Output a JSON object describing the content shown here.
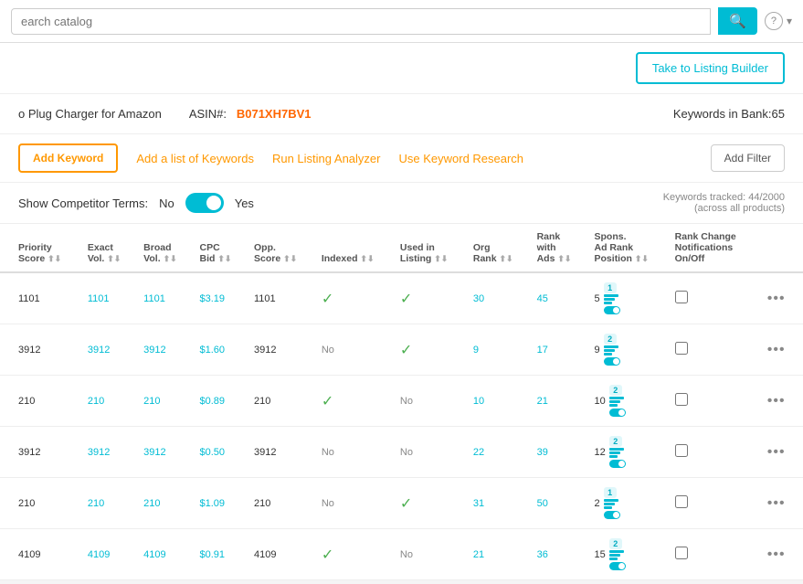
{
  "topbar": {
    "search_placeholder": "earch catalog",
    "search_icon": "🔍",
    "help_icon": "?"
  },
  "action_bar": {
    "listing_builder_label": "Take to Listing Builder"
  },
  "product": {
    "name": "o Plug Charger for Amazon",
    "asin_label": "ASIN#:",
    "asin_value": "B071XH7BV1",
    "keywords_in_bank": "Keywords in Bank:",
    "keywords_count": "65"
  },
  "toolbar": {
    "add_keyword": "Add Keyword",
    "add_list": "Add a list of Keywords",
    "run_analyzer": "Run Listing Analyzer",
    "use_research": "Use Keyword Research",
    "add_filter": "Add Filter"
  },
  "competitor": {
    "label": "Show Competitor Terms:",
    "no": "No",
    "yes": "Yes",
    "tracked_label": "Keywords tracked: 44/2000",
    "tracked_sub": "(across all products)"
  },
  "table": {
    "headers": [
      "Priority Score",
      "Exact Vol.",
      "Broad Vol.",
      "CPC Bid",
      "Opp. Score",
      "Indexed",
      "Used in Listing",
      "Org Rank",
      "Rank with Ads",
      "Spons. Ad Rank Position",
      "Rank Change Notifications On/Off"
    ],
    "rows": [
      {
        "priority": "1101",
        "exact": "1101",
        "broad": "1101",
        "cpc": "$3.19",
        "opp": "1101",
        "indexed": true,
        "indexed_text": "",
        "used_in_listing": true,
        "used_text": "",
        "org_rank": "30",
        "rank_with_ads": "45",
        "spons_rank": "5",
        "spons_badge": "1",
        "checked": false
      },
      {
        "priority": "3912",
        "exact": "3912",
        "broad": "3912",
        "cpc": "$1.60",
        "opp": "3912",
        "indexed": false,
        "indexed_text": "No",
        "used_in_listing": true,
        "used_text": "",
        "org_rank": "9",
        "rank_with_ads": "17",
        "spons_rank": "9",
        "spons_badge": "2",
        "checked": false
      },
      {
        "priority": "210",
        "exact": "210",
        "broad": "210",
        "cpc": "$0.89",
        "opp": "210",
        "indexed": true,
        "indexed_text": "",
        "used_in_listing": false,
        "used_text": "No",
        "org_rank": "10",
        "rank_with_ads": "21",
        "spons_rank": "10",
        "spons_badge": "2",
        "checked": false
      },
      {
        "priority": "3912",
        "exact": "3912",
        "broad": "3912",
        "cpc": "$0.50",
        "opp": "3912",
        "indexed": false,
        "indexed_text": "No",
        "used_in_listing": false,
        "used_text": "No",
        "org_rank": "22",
        "rank_with_ads": "39",
        "spons_rank": "12",
        "spons_badge": "2",
        "checked": false
      },
      {
        "priority": "210",
        "exact": "210",
        "broad": "210",
        "cpc": "$1.09",
        "opp": "210",
        "indexed": false,
        "indexed_text": "No",
        "used_in_listing": true,
        "used_text": "",
        "org_rank": "31",
        "rank_with_ads": "50",
        "spons_rank": "2",
        "spons_badge": "1",
        "checked": false
      },
      {
        "priority": "4109",
        "exact": "4109",
        "broad": "4109",
        "cpc": "$0.91",
        "opp": "4109",
        "indexed": true,
        "indexed_text": "",
        "used_in_listing": false,
        "used_text": "No",
        "org_rank": "21",
        "rank_with_ads": "36",
        "spons_rank": "15",
        "spons_badge": "2",
        "checked": false
      }
    ]
  }
}
